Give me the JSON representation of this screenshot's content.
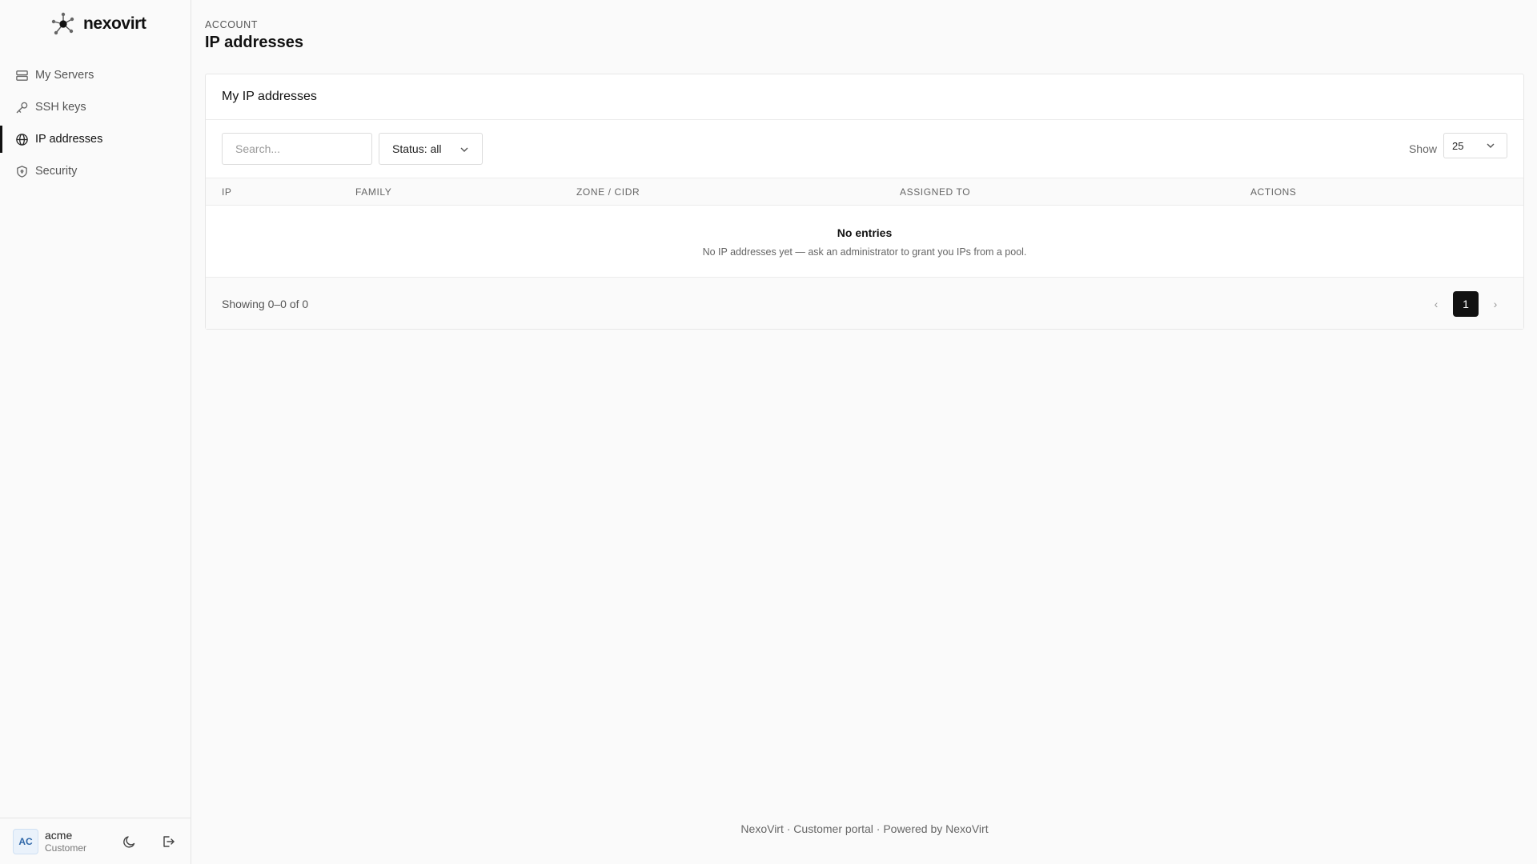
{
  "brand": {
    "name": "nexovirt"
  },
  "sidebar": {
    "items": [
      {
        "label": "My Servers",
        "icon": "server-icon",
        "active": false
      },
      {
        "label": "SSH keys",
        "icon": "key-icon",
        "active": false
      },
      {
        "label": "IP addresses",
        "icon": "globe-icon",
        "active": true
      },
      {
        "label": "Security",
        "icon": "shield-icon",
        "active": false
      }
    ],
    "user": {
      "initials": "AC",
      "name": "acme",
      "role": "Customer"
    }
  },
  "header": {
    "eyebrow": "ACCOUNT",
    "title": "IP addresses"
  },
  "card": {
    "title": "My IP addresses",
    "search": {
      "placeholder": "Search...",
      "value": ""
    },
    "status_filter": "Status: all",
    "show_label": "Show",
    "page_size": "25",
    "columns": [
      "IP",
      "FAMILY",
      "ZONE / CIDR",
      "ASSIGNED TO",
      "ACTIONS"
    ],
    "empty": {
      "title": "No entries",
      "message": "No IP addresses yet — ask an administrator to grant you IPs from a pool."
    },
    "footer": {
      "showing": "Showing 0–0 of 0",
      "prev": "‹",
      "page": "1",
      "next": "›"
    }
  },
  "page_footer": "NexoVirt · Customer portal · Powered by NexoVirt",
  "colors": {
    "accent": "#111111",
    "avatar_bg": "#eaf2fb",
    "avatar_text": "#2f67a8"
  }
}
